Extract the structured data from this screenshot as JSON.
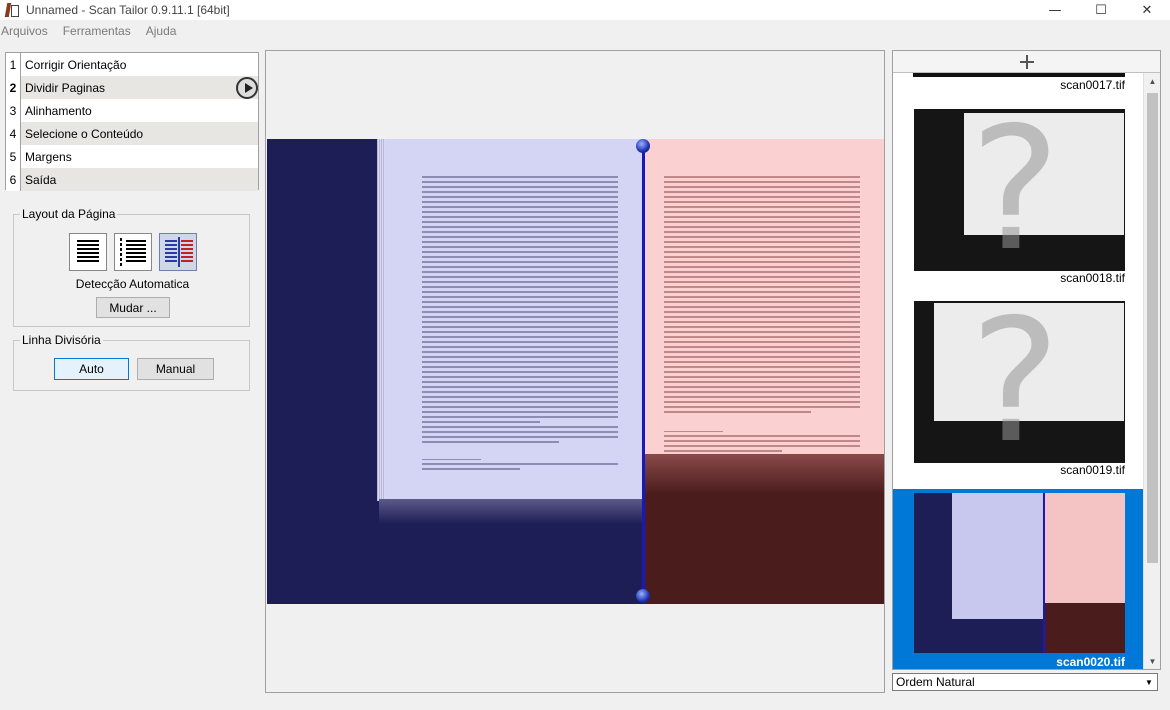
{
  "window": {
    "title": "Unnamed - Scan Tailor 0.9.11.1 [64bit]",
    "minimize": "—",
    "maximize": "☐",
    "close": "✕"
  },
  "menu": [
    "Arquivos",
    "Ferramentas",
    "Ajuda"
  ],
  "stages": [
    {
      "num": "1",
      "label": "Corrigir Orientação"
    },
    {
      "num": "2",
      "label": "Dividir Paginas"
    },
    {
      "num": "3",
      "label": "Alinhamento"
    },
    {
      "num": "4",
      "label": "Selecione o Conteúdo"
    },
    {
      "num": "5",
      "label": "Margens"
    },
    {
      "num": "6",
      "label": "Saída"
    }
  ],
  "selected_stage": 2,
  "layout": {
    "group_title": "Layout da Página",
    "detection_label": "Detecção Automatica",
    "change_button": "Mudar ..."
  },
  "split_line": {
    "group_title": "Linha Divisória",
    "auto_button": "Auto",
    "manual_button": "Manual"
  },
  "thumbnails": [
    {
      "name": "scan0017.tif"
    },
    {
      "name": "scan0018.tif"
    },
    {
      "name": "scan0019.tif"
    },
    {
      "name": "scan0020.tif"
    }
  ],
  "selected_thumbnail": "scan0020.tif",
  "sort_order": "Ordem Natural",
  "colors": {
    "left_page_tint": "#d4d4f4",
    "right_page_tint": "#fbd0d0",
    "split_line": "#1818c0",
    "selection": "#0078d7"
  }
}
